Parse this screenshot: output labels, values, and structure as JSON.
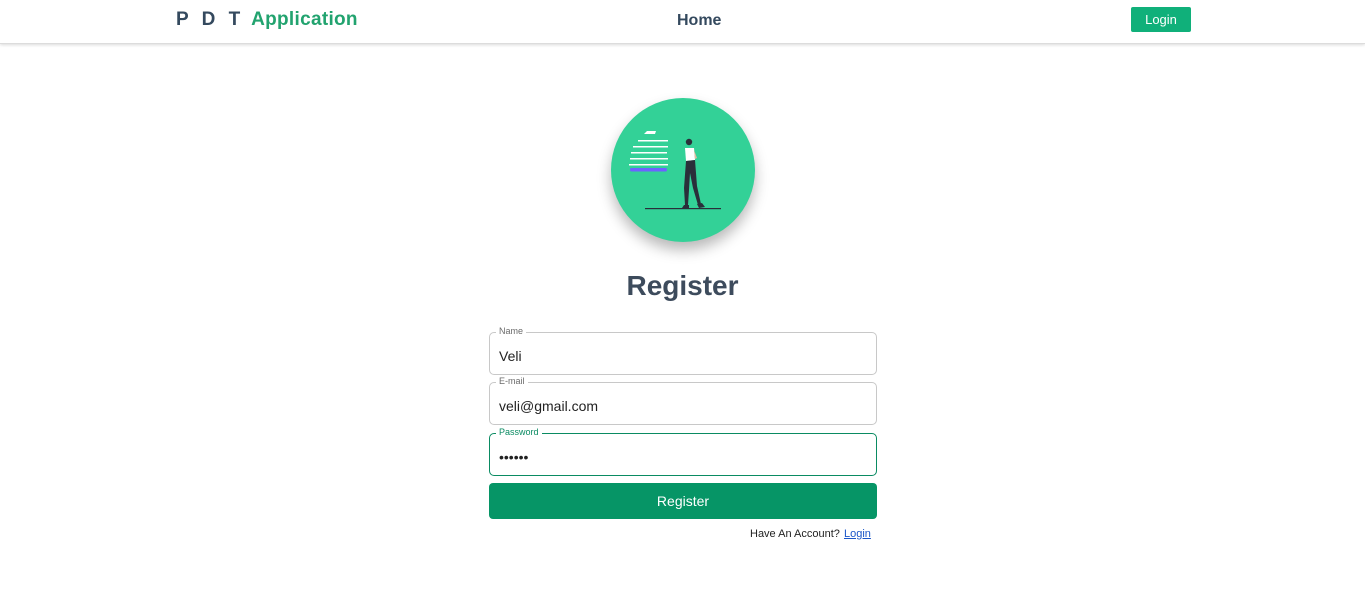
{
  "navbar": {
    "brand_part1": "P D T",
    "brand_part2": "Application",
    "home_label": "Home",
    "login_label": "Login"
  },
  "illustration": {
    "icon": "person-walking-illustration-icon",
    "bg_color": "#33d197"
  },
  "form": {
    "title": "Register",
    "fields": [
      {
        "label": "Name",
        "value": "Veli"
      },
      {
        "label": "E-mail",
        "value": "veli@gmail.com"
      },
      {
        "label": "Password",
        "value": "••••••",
        "focused": true
      }
    ],
    "submit_label": "Register",
    "have_account_text": "Have An Account?",
    "login_link_label": "Login"
  },
  "colors": {
    "accent": "#10b07a",
    "button": "#069566",
    "text_dark": "#34495e"
  }
}
